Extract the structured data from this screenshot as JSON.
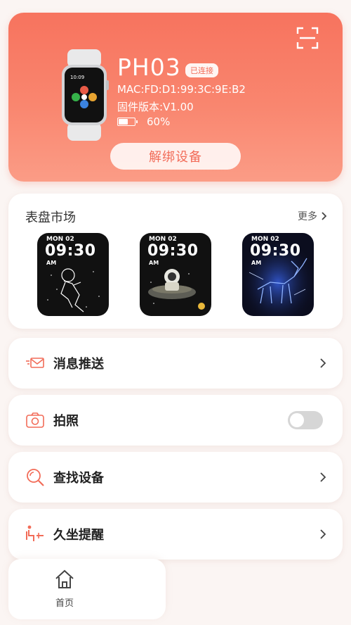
{
  "device": {
    "name": "PH03",
    "status_badge": "已连接",
    "mac": "MAC:FD:D1:99:3C:9E:B2",
    "firmware": "固件版本:V1.00",
    "battery_level": 0.6,
    "battery_text": "60%",
    "unbind_label": "解绑设备"
  },
  "faces": {
    "title": "表盘市场",
    "more_label": "更多",
    "items": [
      {
        "date": "MON 02",
        "time": "09:30",
        "ampm": "AM",
        "theme": "astronaut-line-art"
      },
      {
        "date": "MON 02",
        "time": "09:30",
        "ampm": "AM",
        "theme": "astronaut-rocket"
      },
      {
        "date": "MON 02",
        "time": "09:30",
        "ampm": "AM",
        "theme": "blue-neon-deer"
      }
    ]
  },
  "menu": {
    "push": {
      "label": "消息推送",
      "icon": "envelope-icon"
    },
    "photo": {
      "label": "拍照",
      "icon": "camera-icon",
      "toggle_on": false
    },
    "find": {
      "label": "查找设备",
      "icon": "search-icon"
    },
    "sedentary": {
      "label": "久坐提醒",
      "icon": "sedentary-icon"
    }
  },
  "nav": {
    "home_label": "首页"
  },
  "colors": {
    "accent": "#f26c58",
    "header_top": "#f7735e",
    "header_bottom": "#fb9c86"
  }
}
